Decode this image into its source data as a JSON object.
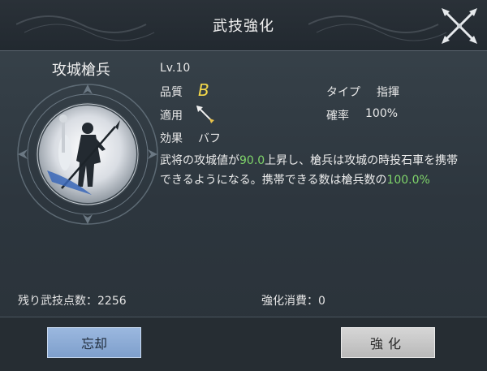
{
  "header": {
    "title": "武技強化"
  },
  "skill": {
    "name": "攻城槍兵",
    "level": "Lv.10",
    "quality_label": "品質",
    "quality_value": "B",
    "type_label": "タイプ",
    "type_value": "指揮",
    "applies_label": "適用",
    "applies_icon": "spear-icon",
    "rate_label": "確率",
    "rate_value": "100%",
    "effect_label": "効果",
    "effect_value": "バフ",
    "description": {
      "part1": "武将の攻城値が",
      "value1": "90.0",
      "part2": "上昇し、槍兵は攻城の時投石車を携帯できるようになる。携帯できる数は槍兵数の",
      "value2": "100.0%"
    }
  },
  "footer": {
    "remaining_points_label": "残り武技点数：",
    "remaining_points_value": "2256",
    "enhance_cost_label": "強化消費：",
    "enhance_cost_value": "0"
  },
  "buttons": {
    "forget_label": "忘却",
    "enhance_label": "強化"
  },
  "colors": {
    "quality_b": "#f4d84a",
    "highlight": "#7fd46a",
    "forget_button": "#8aa9d4",
    "enhance_button": "#c7c7c7"
  }
}
